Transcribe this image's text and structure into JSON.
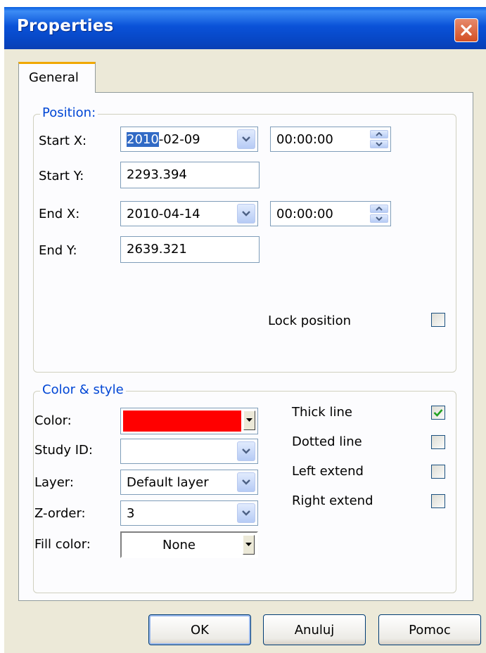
{
  "window": {
    "title": "Properties"
  },
  "tabs": [
    {
      "label": "General",
      "active": true
    }
  ],
  "position": {
    "legend": "Position:",
    "start_x": {
      "label": "Start X:",
      "date_selected": "2010",
      "date_rest": "-02-09",
      "time": "00:00:00"
    },
    "start_y": {
      "label": "Start Y:",
      "value": "2293.394"
    },
    "end_x": {
      "label": "End X:",
      "date": "2010-04-14",
      "time": "00:00:00"
    },
    "end_y": {
      "label": "End Y:",
      "value": "2639.321"
    },
    "lock_position": {
      "label": "Lock position",
      "checked": false
    }
  },
  "color_style": {
    "legend": "Color & style",
    "color": {
      "label": "Color:",
      "value_color": "#ff0000"
    },
    "study_id": {
      "label": "Study ID:",
      "value": ""
    },
    "layer": {
      "label": "Layer:",
      "value": "Default layer"
    },
    "z_order": {
      "label": "Z-order:",
      "value": "3"
    },
    "fill_color": {
      "label": "Fill color:",
      "value": "None"
    },
    "thick_line": {
      "label": "Thick line",
      "checked": true
    },
    "dotted_line": {
      "label": "Dotted line",
      "checked": false
    },
    "left_extend": {
      "label": "Left extend",
      "checked": false
    },
    "right_extend": {
      "label": "Right extend",
      "checked": false
    }
  },
  "buttons": {
    "ok": "OK",
    "cancel": "Anuluj",
    "help": "Pomoc"
  },
  "colors": {
    "titlebar": "#0a52d8",
    "accent_tab": "#f0a800",
    "legend_text": "#0046d5",
    "check": "#21a121"
  },
  "icons": {
    "close": "close-icon",
    "dropdown": "chevron-down-icon",
    "spinner": "spinner-arrows-icon",
    "check": "checkmark-icon"
  }
}
